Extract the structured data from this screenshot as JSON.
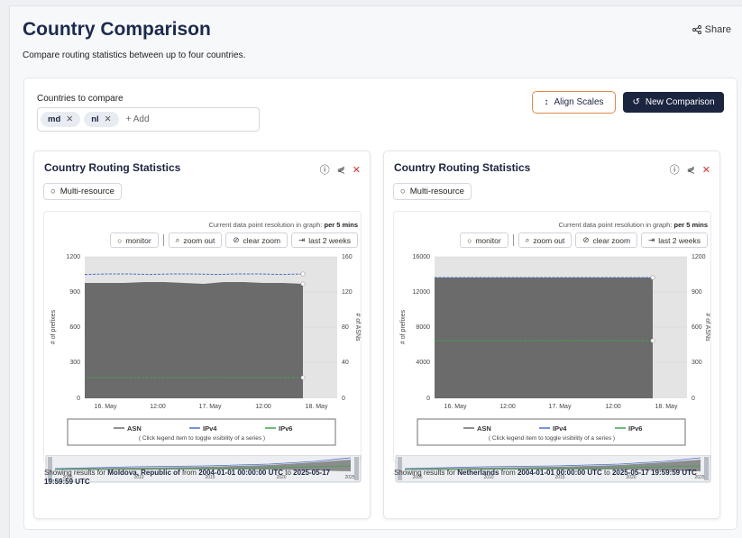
{
  "page": {
    "title": "Country Comparison",
    "subtitle": "Compare routing statistics between up to four countries.",
    "share_label": "Share"
  },
  "form": {
    "countries_label": "Countries to compare",
    "tags": [
      "md",
      "nl"
    ],
    "add_placeholder": "+ Add",
    "align_label": "Align Scales",
    "new_comparison_label": "New Comparison"
  },
  "cards": [
    {
      "title": "Country Routing Statistics",
      "multi_resource": "Multi-resource",
      "resolution_prefix": "Current data point resolution in graph:",
      "resolution_value": "per 5 mins",
      "btn_monitor": "monitor",
      "btn_zoom_out": "zoom out",
      "btn_clear_zoom": "clear zoom",
      "btn_last": "last 2 weeks",
      "y_left_label": "# of prefixes",
      "y_right_label": "# of ASNs",
      "y_left_ticks": [
        "1200",
        "900",
        "600",
        "300",
        "0"
      ],
      "y_right_ticks": [
        "160",
        "120",
        "80",
        "40",
        "0"
      ],
      "x_ticks": [
        "16. May",
        "12:00",
        "17. May",
        "12:00",
        "18. May"
      ],
      "legend": [
        "ASN",
        "IPv4",
        "IPv6"
      ],
      "legend_hint": "( Click legend item to toggle visibility of a series )",
      "nav_years": [
        "2005",
        "2010",
        "2015",
        "2020",
        "2025"
      ],
      "results_prefix": "Showing results for",
      "country": "Moldova, Republic of",
      "from_word": "from",
      "start": "2004-01-01 00:00:00 UTC",
      "to_word": "to",
      "end": "2025-05-17 19:59:59 UTC"
    },
    {
      "title": "Country Routing Statistics",
      "multi_resource": "Multi-resource",
      "resolution_prefix": "Current data point resolution in graph:",
      "resolution_value": "per 5 mins",
      "btn_monitor": "monitor",
      "btn_zoom_out": "zoom out",
      "btn_clear_zoom": "clear zoom",
      "btn_last": "last 2 weeks",
      "y_left_label": "# of prefixes",
      "y_right_label": "# of ASNs",
      "y_left_ticks": [
        "16000",
        "12000",
        "8000",
        "4000",
        "0"
      ],
      "y_right_ticks": [
        "1200",
        "900",
        "600",
        "300",
        "0"
      ],
      "x_ticks": [
        "16. May",
        "12:00",
        "17. May",
        "12:00",
        "18. May"
      ],
      "legend": [
        "ASN",
        "IPv4",
        "IPv6"
      ],
      "legend_hint": "( Click legend item to toggle visibility of a series )",
      "nav_years": [
        "2005",
        "2010",
        "2015",
        "2020",
        "2025"
      ],
      "results_prefix": "Showing results for",
      "country": "Netherlands",
      "from_word": "from",
      "start": "2004-01-01 00:00:00 UTC",
      "to_word": "to",
      "end": "2025-05-17 19:59:59 UTC"
    }
  ],
  "colors": {
    "navy": "#1b2540",
    "accent_orange": "#e0884a",
    "close_red": "#d33333",
    "area_gray": "#6b6b6b",
    "ipv4_blue": "#4a6fc7",
    "ipv6_green": "#3fa34d"
  }
}
